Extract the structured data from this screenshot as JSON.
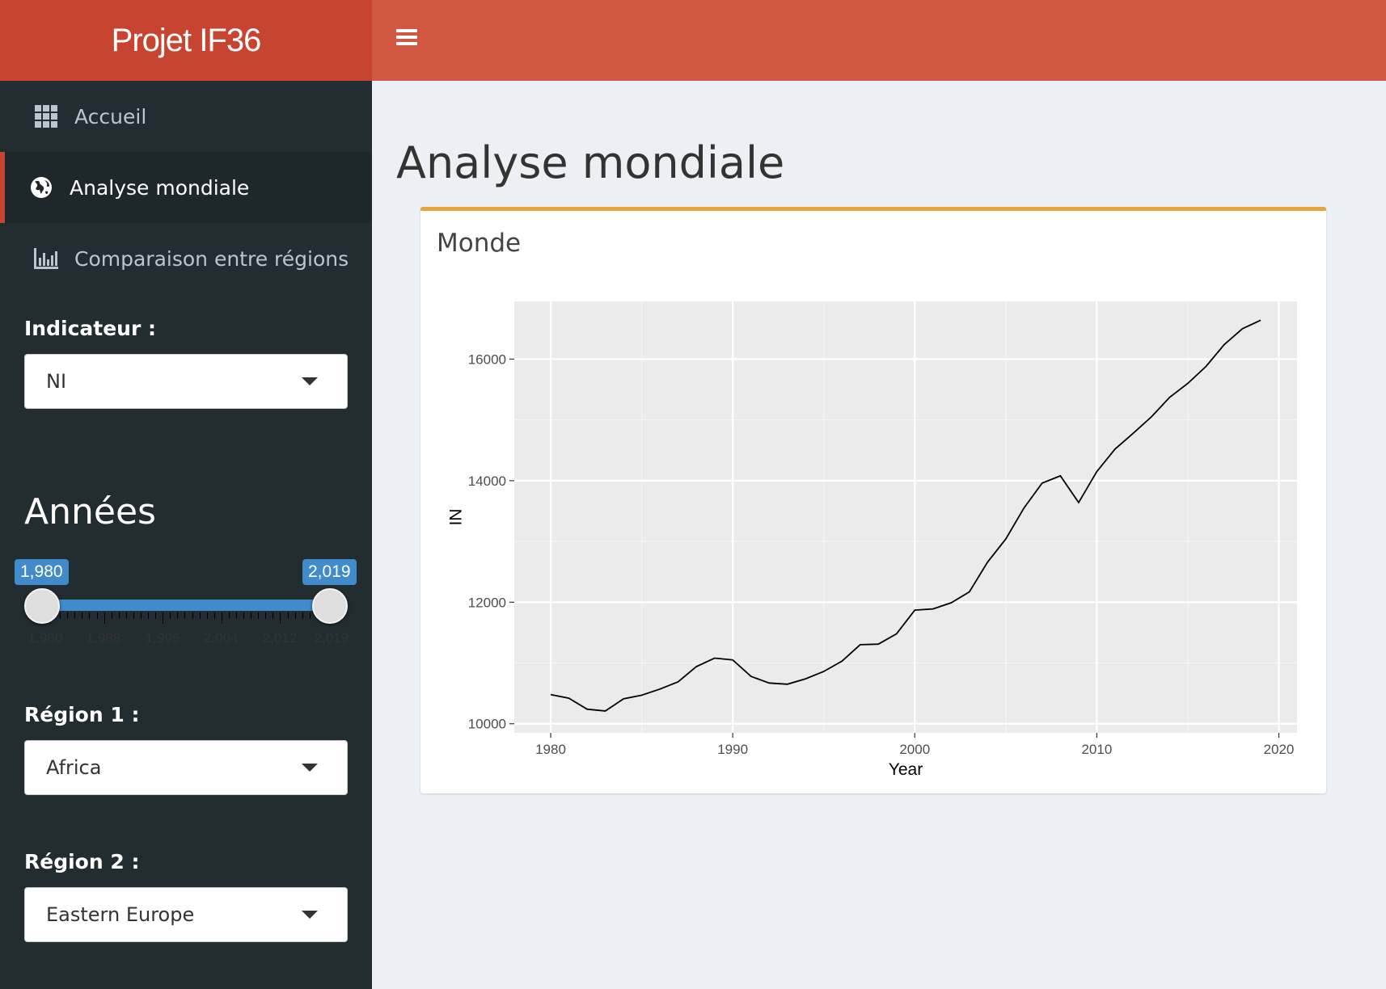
{
  "app": {
    "title": "Projet IF36"
  },
  "sidebar": {
    "items": [
      {
        "label": "Accueil",
        "icon": "grid-icon"
      },
      {
        "label": "Analyse mondiale",
        "icon": "globe-icon",
        "active": true
      },
      {
        "label": "Comparaison entre régions",
        "icon": "bar-chart-icon"
      }
    ],
    "indicator_label": "Indicateur :",
    "indicator_value": "NI",
    "years_label": "Années",
    "year_slider": {
      "from": "1,980",
      "to": "2,019",
      "min": 1980,
      "max": 2019,
      "tick_labels": [
        "1,980",
        "1,988",
        "1,996",
        "2,004",
        "2,012",
        "2,019"
      ]
    },
    "region1_label": "Région 1 :",
    "region1_value": "Africa",
    "region2_label": "Région 2 :",
    "region2_value": "Eastern Europe"
  },
  "main": {
    "title": "Analyse mondiale",
    "box_title": "Monde"
  },
  "colors": {
    "header_logo": "#c64430",
    "header_bar": "#d15843",
    "sidebar": "#222d32",
    "box_border": "#e8a33d",
    "slider": "#428bca"
  },
  "chart_data": {
    "type": "line",
    "xlabel": "Year",
    "ylabel": "NI",
    "xlim": [
      1978,
      2021
    ],
    "ylim": [
      9850,
      16950
    ],
    "x_ticks": [
      1980,
      1990,
      2000,
      2010,
      2020
    ],
    "y_ticks": [
      10000,
      12000,
      14000,
      16000
    ],
    "grid": true,
    "x": [
      1980,
      1981,
      1982,
      1983,
      1984,
      1985,
      1986,
      1987,
      1988,
      1989,
      1990,
      1991,
      1992,
      1993,
      1994,
      1995,
      1996,
      1997,
      1998,
      1999,
      2000,
      2001,
      2002,
      2003,
      2004,
      2005,
      2006,
      2007,
      2008,
      2009,
      2010,
      2011,
      2012,
      2013,
      2014,
      2015,
      2016,
      2017,
      2018,
      2019
    ],
    "y": [
      10480,
      10420,
      10240,
      10210,
      10410,
      10470,
      10570,
      10690,
      10940,
      11080,
      11050,
      10780,
      10670,
      10650,
      10740,
      10860,
      11030,
      11300,
      11310,
      11480,
      11870,
      11890,
      11990,
      12170,
      12660,
      13040,
      13550,
      13960,
      14080,
      13640,
      14150,
      14520,
      14780,
      15050,
      15370,
      15600,
      15880,
      16240,
      16500,
      16640
    ]
  }
}
